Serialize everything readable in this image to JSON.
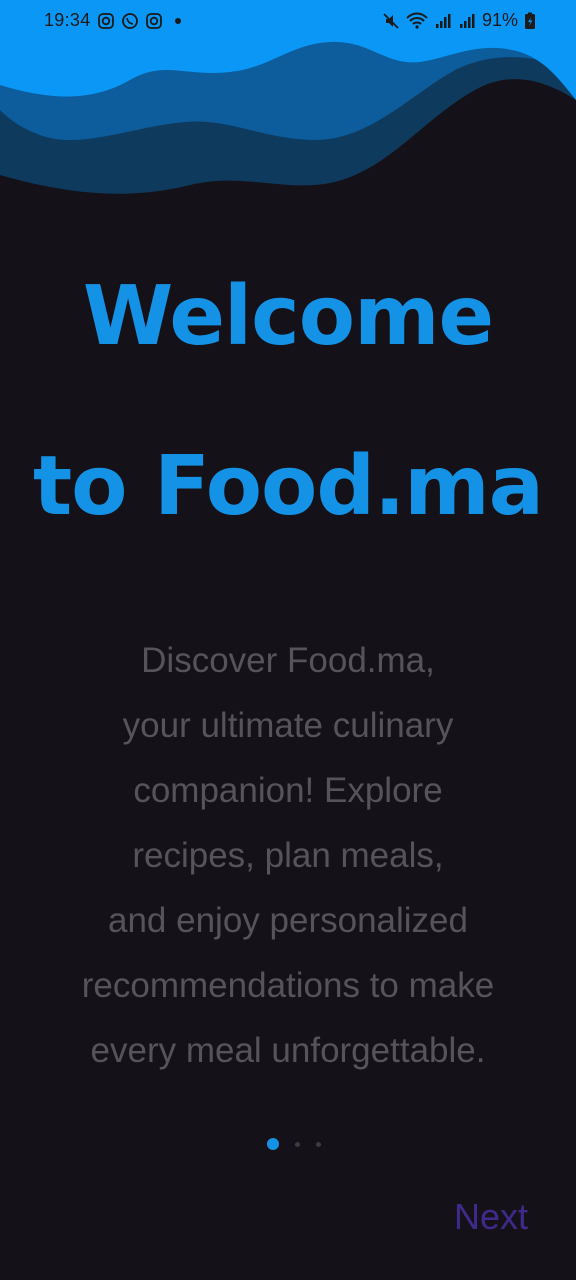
{
  "status_bar": {
    "time": "19:34",
    "battery": "91%"
  },
  "onboarding": {
    "title_line1": "Welcome",
    "title_line2": "to Food.ma",
    "description": "Discover Food.ma,\nyour ultimate culinary\ncompanion! Explore\nrecipes, plan meals,\nand enjoy personalized\nrecommendations to make\nevery meal unforgettable.",
    "pages": 3,
    "active_page": 1,
    "next_label": "Next"
  },
  "colors": {
    "background": "#141218",
    "accent": "#1493E6",
    "wave_light": "#0A97F5",
    "wave_mid": "#0D5C9C",
    "wave_dark": "#0E3A5E",
    "next": "#3F2A8C"
  }
}
